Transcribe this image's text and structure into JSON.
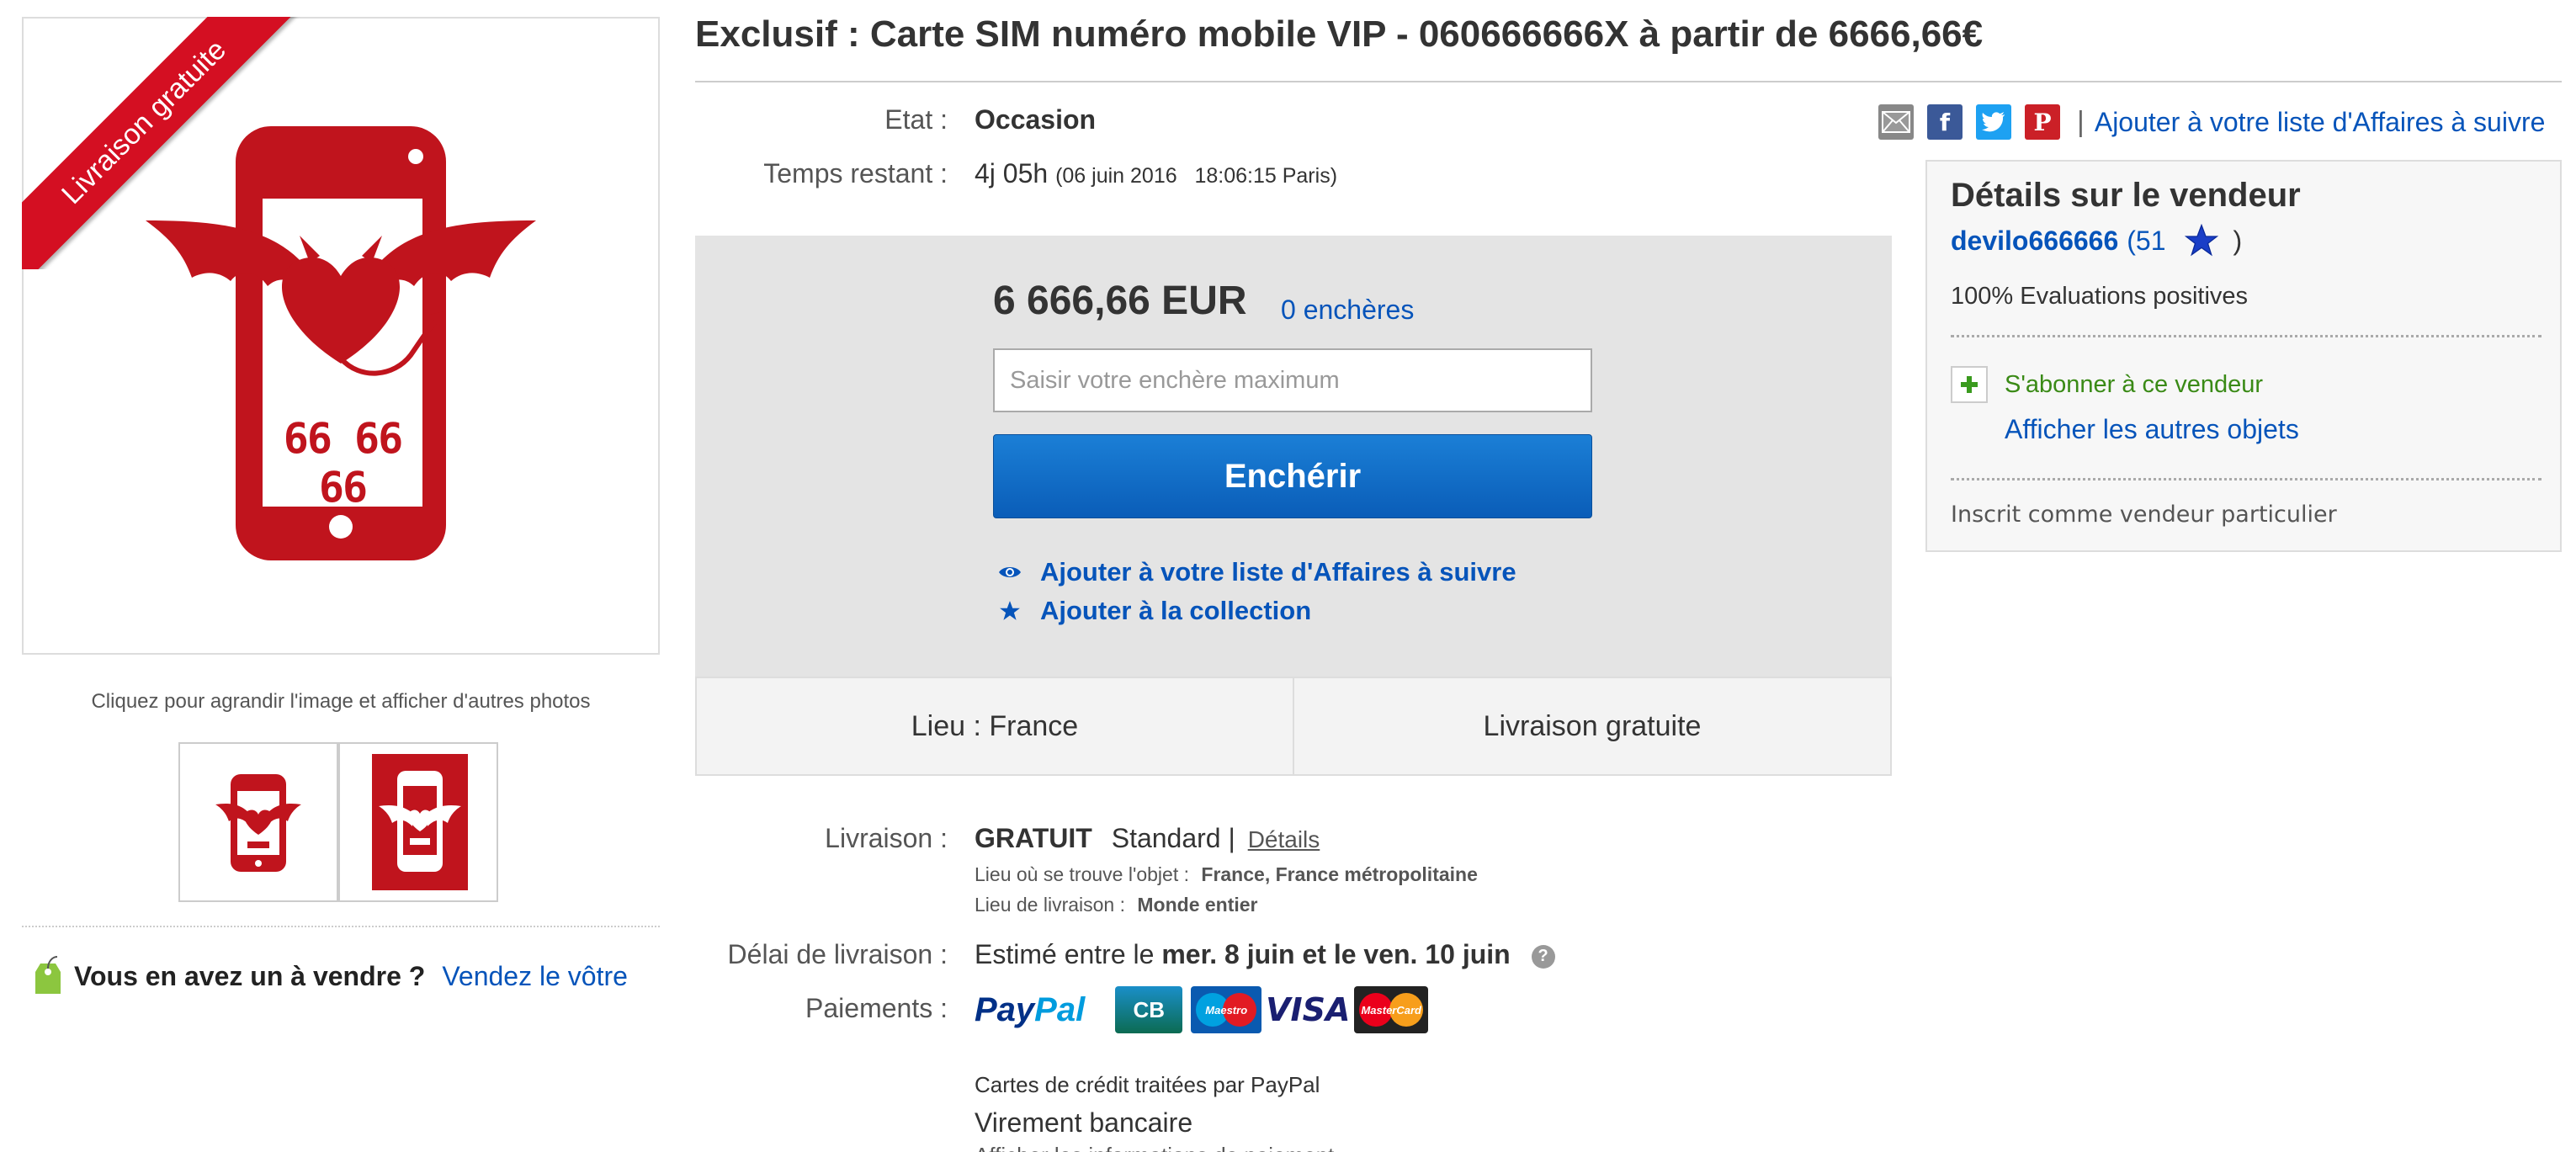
{
  "listing": {
    "title": "Exclusif : Carte SIM numéro mobile VIP - 060666666X à partir de 6666,66€"
  },
  "gallery": {
    "ribbon_text": "Livraison gratuite",
    "phone_number_text": "66 66 66",
    "enlarge_hint": "Cliquez pour agrandir l'image et afficher d'autres photos",
    "sell_question": "Vous en avez un à vendre ?",
    "sell_link": "Vendez le vôtre"
  },
  "details": {
    "condition_label": "Etat :",
    "condition_value": "Occasion",
    "time_label": "Temps restant :",
    "time_value": "4j 05h",
    "time_end": "(06 juin 2016   18:06:15 Paris)"
  },
  "bid": {
    "price": "6 666,66 EUR",
    "bid_count": "0 enchères",
    "input_placeholder": "Saisir votre enchère maximum",
    "button_label": "Enchérir",
    "watch_label": "Ajouter à votre liste d'Affaires à suivre",
    "collection_label": "Ajouter à la collection",
    "location": "Lieu : France",
    "shipping_summary": "Livraison gratuite"
  },
  "share": {
    "icons": [
      "email-icon",
      "facebook-icon",
      "twitter-icon",
      "pinterest-icon"
    ],
    "separator": "|",
    "watch_link": "Ajouter à votre liste d'Affaires à suivre"
  },
  "seller": {
    "heading": "Détails sur le vendeur",
    "username": "devilo666666",
    "feedback_open": "(51",
    "feedback_close": ")",
    "positive": "100% Evaluations positives",
    "subscribe": "S'abonner à ce vendeur",
    "other_items": "Afficher les autres objets",
    "seller_type": "Inscrit comme vendeur particulier"
  },
  "shipping": {
    "label": "Livraison :",
    "price": "GRATUIT",
    "method": "Standard |",
    "details_link": "Détails",
    "item_location_label": "Lieu où se trouve l'objet :",
    "item_location_value": "France, France métropolitaine",
    "ships_to_label": "Lieu de livraison :",
    "ships_to_value": "Monde entier"
  },
  "delivery": {
    "label": "Délai de livraison :",
    "prefix": "Estimé entre le",
    "range": "mer. 8 juin et le ven. 10 juin",
    "help": "?"
  },
  "payments": {
    "label": "Paiements :",
    "paypal_part1": "Pay",
    "paypal_part2": "Pal",
    "card_cb": "CB",
    "card_maestro": "Maestro",
    "card_visa": "VISA",
    "card_mastercard": "MasterCard",
    "cards_note": "Cartes de crédit traitées par PayPal",
    "bank_transfer": "Virement bancaire",
    "info_link": "Afficher les informations de paiement"
  },
  "colors": {
    "brand_red": "#c0141d",
    "link_blue": "#0654ba",
    "button_blue": "#0a5db8",
    "subscribe_green": "#3a8a16"
  }
}
